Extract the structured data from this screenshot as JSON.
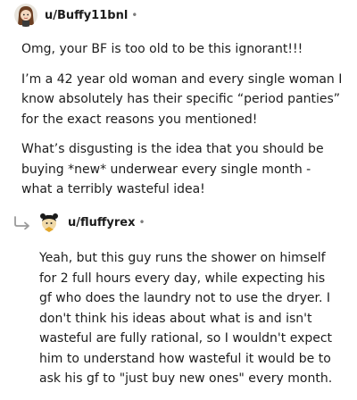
{
  "comment1": {
    "username": "u/Buffy11bnl",
    "separator": "•",
    "paragraphs": [
      "Omg, your BF is too old to be this ignorant!!!",
      "I’m a 42 year old woman and every single woman I know absolutely has their specific “period panties” for the exact reasons you mentioned!",
      "What’s disgusting is the idea that you should be buying *new* underwear every single month - what a terribly wasteful idea!"
    ]
  },
  "comment2": {
    "username": "u/fluffyrex",
    "separator": "•",
    "paragraphs": [
      "Yeah, but this guy runs the shower on himself for 2 full hours every day, while expecting his gf who does the laundry not to use the dryer. I don't think his ideas about what is and isn't wasteful are fully rational, so I wouldn't expect him to understand how wasteful it would be to ask his gf to \"just buy new ones\" every month."
    ]
  }
}
